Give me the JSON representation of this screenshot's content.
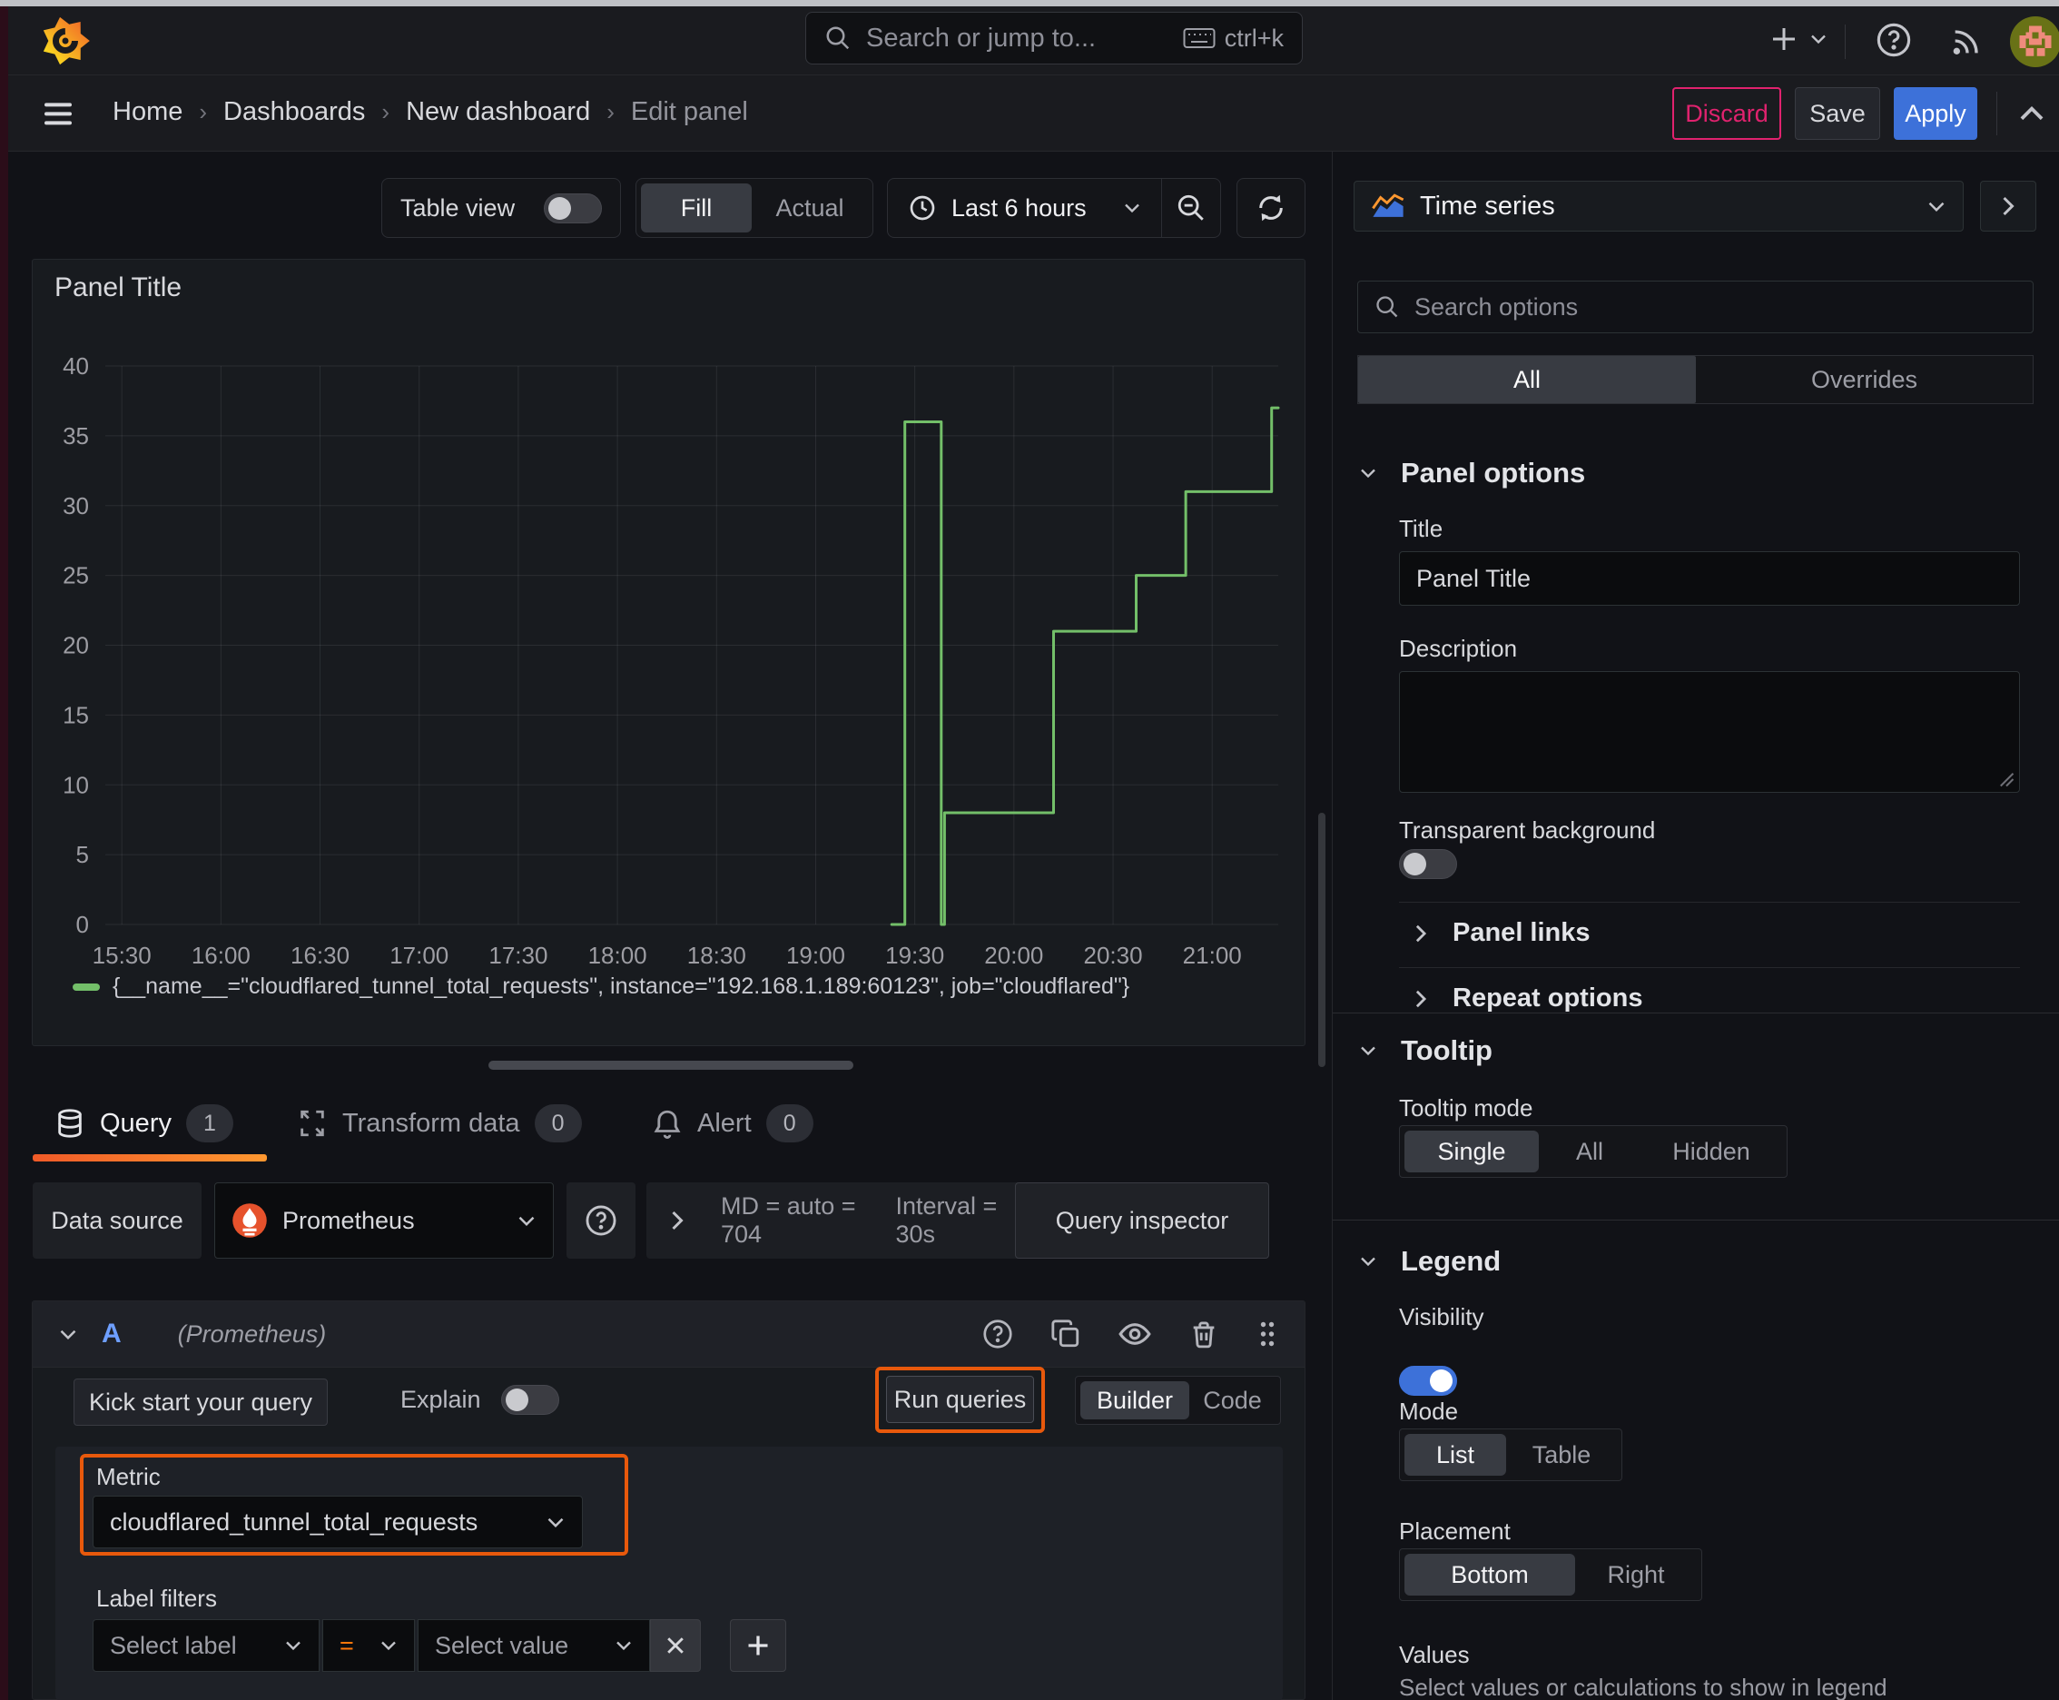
{
  "topnav": {
    "search_placeholder": "Search or jump to...",
    "shortcut": "ctrl+k"
  },
  "breadcrumbs": [
    "Home",
    "Dashboards",
    "New dashboard",
    "Edit panel"
  ],
  "header_actions": {
    "discard": "Discard",
    "save": "Save",
    "apply": "Apply"
  },
  "toolbar": {
    "table_view": "Table view",
    "fill": "Fill",
    "actual": "Actual",
    "time_range": "Last 6 hours"
  },
  "viz_picker": {
    "label": "Time series"
  },
  "options_pane": {
    "search_placeholder": "Search options",
    "filter_tabs": {
      "all": "All",
      "overrides": "Overrides"
    },
    "panel_options": {
      "header": "Panel options",
      "title_label": "Title",
      "title_value": "Panel Title",
      "description_label": "Description",
      "transparent_label": "Transparent background"
    },
    "panel_links": "Panel links",
    "repeat_options": "Repeat options",
    "tooltip": {
      "header": "Tooltip",
      "mode_label": "Tooltip mode",
      "modes": [
        "Single",
        "All",
        "Hidden"
      ],
      "selected": "Single"
    },
    "legend": {
      "header": "Legend",
      "visibility_label": "Visibility",
      "mode_label": "Mode",
      "modes": [
        "List",
        "Table"
      ],
      "selected_mode": "List",
      "placement_label": "Placement",
      "placements": [
        "Bottom",
        "Right"
      ],
      "selected_placement": "Bottom",
      "values_label": "Values",
      "values_help": "Select values or calculations to show in legend"
    }
  },
  "panel": {
    "title": "Panel Title"
  },
  "chart_data": {
    "type": "line",
    "step": "after",
    "title": "Panel Title",
    "x_range": [
      "15:25",
      "21:20"
    ],
    "ylim": [
      0,
      40
    ],
    "x_ticks": [
      "15:30",
      "16:00",
      "16:30",
      "17:00",
      "17:30",
      "18:00",
      "18:30",
      "19:00",
      "19:30",
      "20:00",
      "20:30",
      "21:00"
    ],
    "y_ticks": [
      0,
      5,
      10,
      15,
      20,
      25,
      30,
      35,
      40
    ],
    "grid": true,
    "legend_position": "bottom",
    "series": [
      {
        "name": "{__name__=\"cloudflared_tunnel_total_requests\", instance=\"192.168.1.189:60123\", job=\"cloudflared\"}",
        "color": "#73bf69",
        "points": [
          [
            "19:23",
            0
          ],
          [
            "19:27",
            36
          ],
          [
            "19:38",
            0
          ],
          [
            "19:39",
            8
          ],
          [
            "20:12",
            21
          ],
          [
            "20:37",
            25
          ],
          [
            "20:52",
            31
          ],
          [
            "21:18",
            37
          ]
        ]
      }
    ]
  },
  "query_pane": {
    "tabs": [
      {
        "label": "Query",
        "count": "1"
      },
      {
        "label": "Transform data",
        "count": "0"
      },
      {
        "label": "Alert",
        "count": "0"
      }
    ],
    "datasource": {
      "label": "Data source",
      "name": "Prometheus",
      "md_stat": "MD = auto = 704",
      "interval_stat": "Interval = 30s",
      "inspector": "Query inspector"
    },
    "query": {
      "ref_id": "A",
      "ds_hint": "(Prometheus)",
      "kick_start": "Kick start your query",
      "explain_label": "Explain",
      "run_label": "Run queries",
      "builder": "Builder",
      "code": "Code",
      "metric_label": "Metric",
      "metric_value": "cloudflared_tunnel_total_requests",
      "label_filters_label": "Label filters",
      "select_label": "Select label",
      "operator": "=",
      "select_value": "Select value"
    }
  },
  "colors": {
    "accent_blue": "#3d71d9",
    "highlight_orange": "#e8590c",
    "series_green": "#73bf69",
    "discard_pink": "#e0226e",
    "tab_gradient_start": "#f05a28",
    "tab_gradient_end": "#ff9830"
  }
}
